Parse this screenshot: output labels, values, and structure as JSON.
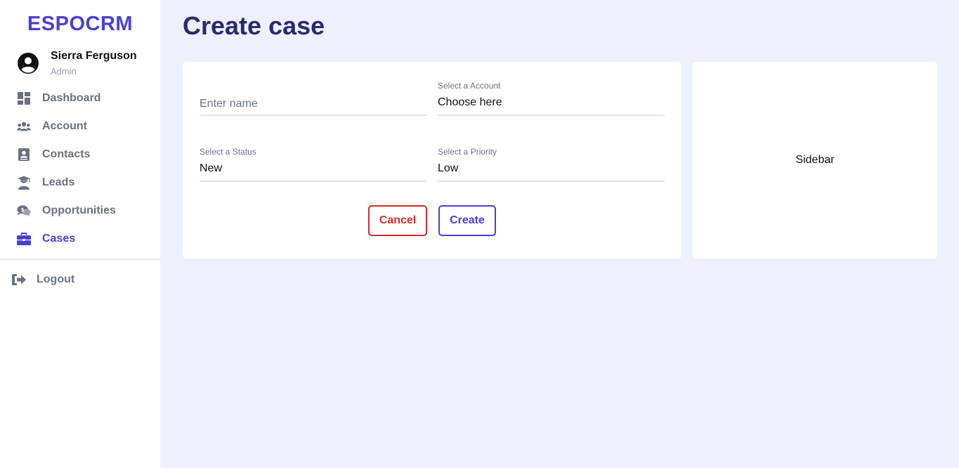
{
  "brand": "ESPOCRM",
  "user": {
    "name": "Sierra Ferguson",
    "role": "Admin"
  },
  "nav": [
    {
      "label": "Dashboard",
      "icon": "dashboard-icon"
    },
    {
      "label": "Account",
      "icon": "users-icon"
    },
    {
      "label": "Contacts",
      "icon": "contact-card-icon"
    },
    {
      "label": "Leads",
      "icon": "graduate-user-icon"
    },
    {
      "label": "Opportunities",
      "icon": "money-chat-icon"
    },
    {
      "label": "Cases",
      "icon": "briefcase-icon",
      "active": true
    }
  ],
  "logout": {
    "label": "Logout",
    "icon": "logout-icon"
  },
  "page": {
    "title": "Create case"
  },
  "form": {
    "name": {
      "placeholder": "Enter name",
      "value": ""
    },
    "account": {
      "label": "Select a Account",
      "value": "Choose here"
    },
    "status": {
      "label": "Select a Status",
      "value": "New"
    },
    "priority": {
      "label": "Select a Priority",
      "value": "Low"
    },
    "cancel_label": "Cancel",
    "create_label": "Create"
  },
  "side_panel": {
    "text": "Sidebar"
  },
  "colors": {
    "accent": "#4a3fd6",
    "danger": "#d12d2d",
    "background": "#eef1fd",
    "title": "#2b2a6e"
  }
}
